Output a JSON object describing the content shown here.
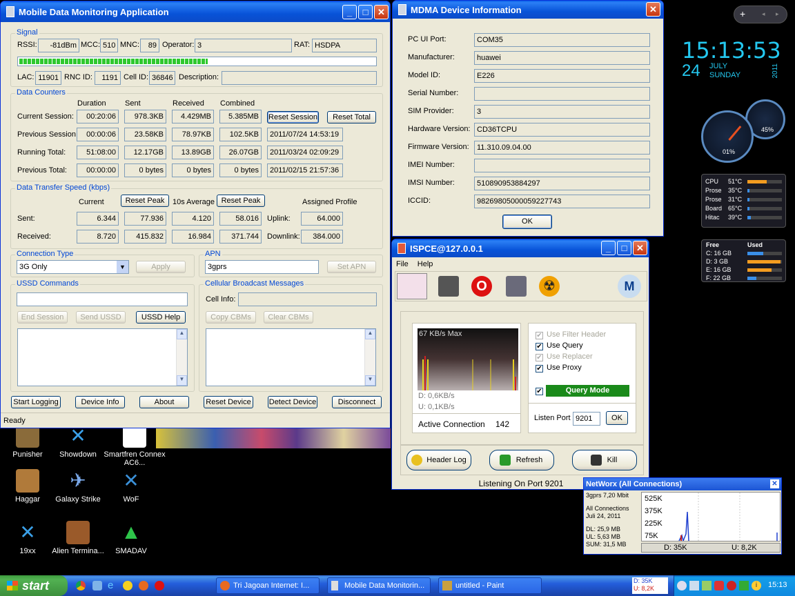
{
  "desktop_icons": [
    {
      "label": "Punisher"
    },
    {
      "label": "Showdown"
    },
    {
      "label": "Smartfren Connex AC6..."
    },
    {
      "label": "Haggar"
    },
    {
      "label": "Galaxy Strike"
    },
    {
      "label": "WoF"
    },
    {
      "label": "19xx"
    },
    {
      "label": "Alien Termina..."
    },
    {
      "label": "SMADAV"
    }
  ],
  "mdma": {
    "title": "Mobile Data Monitoring Application",
    "signal": {
      "group": "Signal",
      "rssi_label": "RSSI:",
      "rssi": "-81dBm",
      "mcc_label": "MCC:",
      "mcc": "510",
      "mnc_label": "MNC:",
      "mnc": "89",
      "operator_label": "Operator:",
      "operator": "3",
      "rat_label": "RAT:",
      "rat": "HSDPA",
      "strength_fraction": 0.53,
      "lac_label": "LAC:",
      "lac": "11901",
      "rnc_label": "RNC ID:",
      "rnc": "1191",
      "cell_label": "Cell ID:",
      "cell": "36846",
      "desc_label": "Description:",
      "desc": ""
    },
    "counters": {
      "group": "Data Counters",
      "headers": [
        "Duration",
        "Sent",
        "Received",
        "Combined"
      ],
      "rows": [
        {
          "label": "Current Session:",
          "duration": "00:20:06",
          "sent": "978.3KB",
          "received": "4.429MB",
          "combined": "5.385MB"
        },
        {
          "label": "Previous Session:",
          "duration": "00:00:06",
          "sent": "23.58KB",
          "received": "78.97KB",
          "combined": "102.5KB",
          "date": "2011/07/24 14:53:19"
        },
        {
          "label": "Running Total:",
          "duration": "51:08:00",
          "sent": "12.17GB",
          "received": "13.89GB",
          "combined": "26.07GB",
          "date": "2011/03/24 02:09:29"
        },
        {
          "label": "Previous Total:",
          "duration": "00:00:00",
          "sent": "0 bytes",
          "received": "0 bytes",
          "combined": "0 bytes",
          "date": "2011/02/15 21:57:36"
        }
      ],
      "reset_session": "Reset Session",
      "reset_total": "Reset Total"
    },
    "speed": {
      "group": "Data Transfer Speed (kbps)",
      "current": "Current",
      "reset_peak": "Reset Peak",
      "avg": "10s Average",
      "profile": "Assigned Profile",
      "sent_label": "Sent:",
      "sent": [
        "6.344",
        "77.936",
        "4.120",
        "58.016"
      ],
      "uplink_label": "Uplink:",
      "uplink": "64.000",
      "recv_label": "Received:",
      "recv": [
        "8.720",
        "415.832",
        "16.984",
        "371.744"
      ],
      "downlink_label": "Downlink:",
      "downlink": "384.000"
    },
    "conn": {
      "group": "Connection Type",
      "value": "3G Only",
      "apply": "Apply"
    },
    "apn": {
      "group": "APN",
      "value": "3gprs",
      "set": "Set APN"
    },
    "ussd": {
      "group": "USSD Commands",
      "value": "",
      "end": "End Session",
      "send": "Send USSD",
      "help": "USSD Help"
    },
    "cbm": {
      "group": "Cellular Broadcast Messages",
      "cell_info_label": "Cell Info:",
      "cell_info": "",
      "copy": "Copy CBMs",
      "clear": "Clear CBMs"
    },
    "buttons": {
      "start_logging": "Start Logging",
      "device_info": "Device Info",
      "about": "About",
      "reset_device": "Reset Device",
      "detect_device": "Detect Device",
      "disconnect": "Disconnect"
    },
    "status": "Ready"
  },
  "devinfo": {
    "title": "MDMA Device Information",
    "rows": [
      {
        "label": "PC UI Port:",
        "value": "COM35"
      },
      {
        "label": "Manufacturer:",
        "value": "huawei"
      },
      {
        "label": "Model ID:",
        "value": "E226"
      },
      {
        "label": "Serial Number:",
        "value": ""
      },
      {
        "label": "SIM Provider:",
        "value": "3"
      },
      {
        "label": "Hardware Version:",
        "value": "CD36TCPU"
      },
      {
        "label": "Firmware Version:",
        "value": "11.310.09.04.00"
      },
      {
        "label": "IMEI Number:",
        "value": ""
      },
      {
        "label": "IMSI Number:",
        "value": "510890953884297"
      },
      {
        "label": "ICCID:",
        "value": "98269805000059227743"
      }
    ],
    "ok": "OK"
  },
  "ispce": {
    "title": "ISPCE@127.0.0.1",
    "menu": [
      "File",
      "Help"
    ],
    "graph_max": "67 KB/s Max",
    "down": "D: 0,6KB/s",
    "up": "U: 0,1KB/s",
    "active_label": "Active Connection",
    "active": "142",
    "options": [
      {
        "label": "Use Filter Header",
        "checked": true,
        "disabled": true
      },
      {
        "label": "Use Query",
        "checked": true,
        "disabled": false
      },
      {
        "label": "Use Replacer",
        "checked": true,
        "disabled": true
      },
      {
        "label": "Use Proxy",
        "checked": true,
        "disabled": false
      }
    ],
    "query_mode": "Query Mode",
    "listen_label": "Listen Port",
    "listen_port": "9201",
    "ok": "OK",
    "header_log": "Header Log",
    "refresh": "Refresh",
    "kill": "Kill",
    "status": "Listening On Port 9201"
  },
  "networx": {
    "title": "NetWorx (All Connections)",
    "line1": "3gprs 7,20 Mbit",
    "line2": "All Connections",
    "line3": "Juli 24, 2011",
    "dl": "DL: 25,9 MB",
    "ul": "UL: 5,63 MB",
    "sum": "SUM: 31,5 MB",
    "yticks": [
      "525K",
      "375K",
      "225K",
      "75K"
    ],
    "d": "D: 35K",
    "u": "U: 8,2K"
  },
  "clock": {
    "time": "15:13:53",
    "day": "24",
    "month": "JULY",
    "weekday": "SUNDAY",
    "year": "2011"
  },
  "meters": {
    "left": "01%",
    "right": "45%"
  },
  "temps": [
    {
      "name": "CPU",
      "value": "51°C",
      "level": 0.55
    },
    {
      "name": "Prose",
      "value": "35°C",
      "level": 0.05
    },
    {
      "name": "Prose",
      "value": "31°C",
      "level": 0.05
    },
    {
      "name": "Board",
      "value": "65°C",
      "level": 0.05
    },
    {
      "name": "Hitac",
      "value": "39°C",
      "level": 0.1
    }
  ],
  "drives": {
    "free_label": "Free",
    "used_label": "Used",
    "items": [
      {
        "label": "C: 16 GB",
        "used": 0.45
      },
      {
        "label": "D: 3 GB",
        "used": 0.95
      },
      {
        "label": "E: 16 GB",
        "used": 0.7
      },
      {
        "label": "F: 22 GB",
        "used": 0.25
      }
    ]
  },
  "taskbar": {
    "start": "start",
    "tasks": [
      "Tri Jagoan Internet: I...",
      "Mobile Data Monitorin...",
      "untitled - Paint"
    ],
    "tray_d": "D: 35K",
    "tray_u": "U: 8,2K",
    "time": "15:13"
  }
}
